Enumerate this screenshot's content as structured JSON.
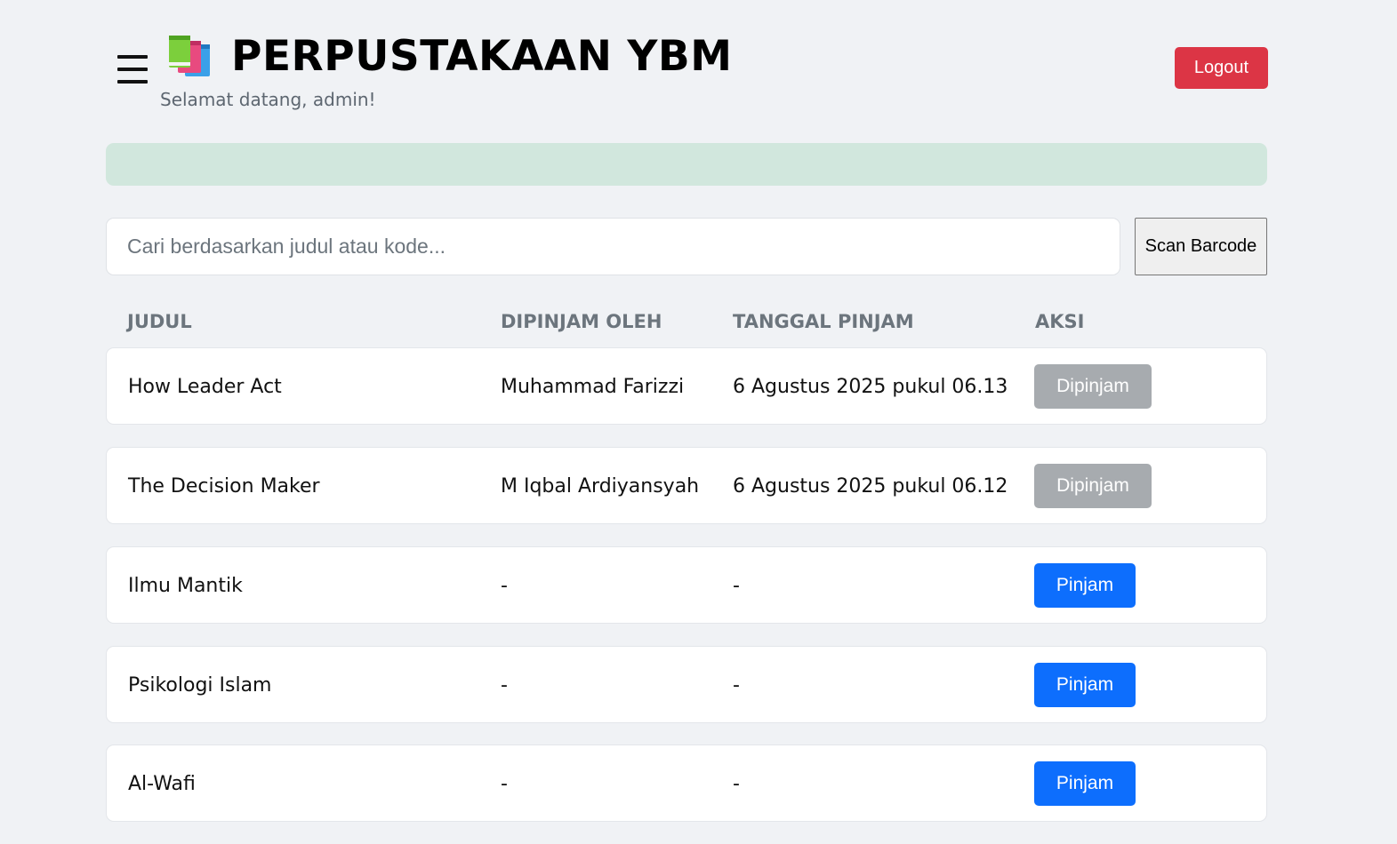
{
  "header": {
    "menu_icon": "hamburger-menu-icon",
    "logo_icon": "books-icon",
    "title": "PERPUSTAKAAN YBM",
    "welcome": "Selamat datang, admin!",
    "logout_label": "Logout"
  },
  "alert": {
    "text": "",
    "color": "#d1e7dd"
  },
  "search": {
    "value": "",
    "placeholder": "Cari berdasarkan judul atau kode...",
    "scan_label": "Scan Barcode"
  },
  "table": {
    "columns": [
      "JUDUL",
      "DIPINJAM OLEH",
      "TANGGAL PINJAM",
      "AKSI"
    ],
    "rows": [
      {
        "title": "How Leader Act",
        "borrower": "Muhammad Farizzi",
        "date": "6 Agustus 2025 pukul 06.13",
        "action": "Dipinjam",
        "status": "borrowed"
      },
      {
        "title": "The Decision Maker",
        "borrower": "M Iqbal Ardiyansyah",
        "date": "6 Agustus 2025 pukul 06.12",
        "action": "Dipinjam",
        "status": "borrowed"
      },
      {
        "title": "Ilmu Mantik",
        "borrower": "-",
        "date": "-",
        "action": "Pinjam",
        "status": "available"
      },
      {
        "title": "Psikologi Islam",
        "borrower": "-",
        "date": "-",
        "action": "Pinjam",
        "status": "available"
      },
      {
        "title": "Al-Wafi",
        "borrower": "-",
        "date": "-",
        "action": "Pinjam",
        "status": "available"
      }
    ]
  },
  "colors": {
    "background": "#f0f2f5",
    "logout": "#dc3545",
    "borrow": "#0d6efd",
    "borrowed": "#a7abaf",
    "header_text": "#6c757d"
  }
}
